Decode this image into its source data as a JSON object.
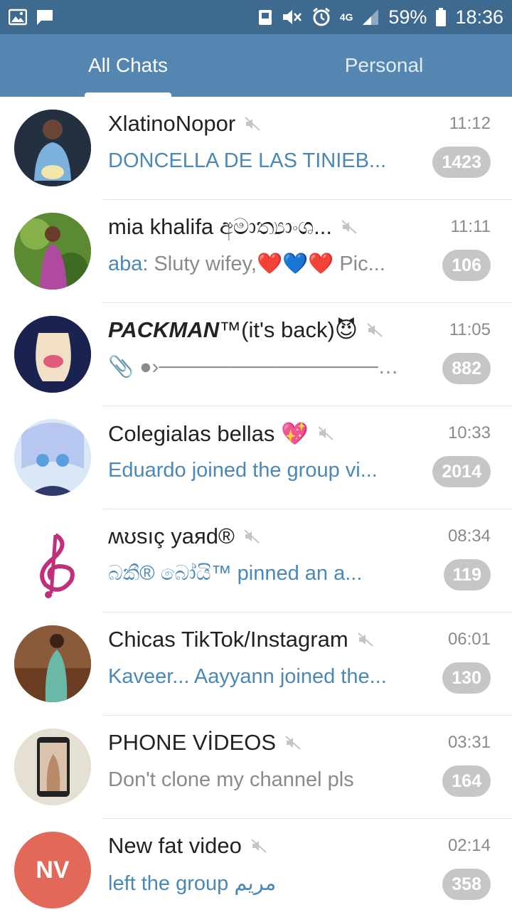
{
  "status_bar": {
    "battery": "59%",
    "time": "18:36",
    "network": "4G",
    "icons": [
      "image-icon",
      "message-icon",
      "save-icon",
      "mute-icon",
      "alarm-icon",
      "signal-icon",
      "battery-icon"
    ]
  },
  "tabs": [
    {
      "label": "All Chats",
      "active": true
    },
    {
      "label": "Personal",
      "active": false
    }
  ],
  "chats": [
    {
      "title": "XlatinoNopor",
      "time": "11:12",
      "preview": "DONCELLA DE LAS TINIEB...",
      "badge": "1423",
      "muted": true
    },
    {
      "title": "mia khalifa අමාත්‍යාංශ...",
      "time": "11:11",
      "preview_sender": "aba:",
      "preview": "Sluty wifey,❤️💙❤️ Pic...",
      "badge": "106",
      "muted": true
    },
    {
      "title_bold": "PACKMAN",
      "title_rest": "™(it's back)😈",
      "time": "11:05",
      "preview": "📎 ●›───────────────── 🔞...",
      "badge": "882",
      "muted": true
    },
    {
      "title": "Colegialas bellas 💖",
      "time": "10:33",
      "preview": "Eduardo joined the group vi...",
      "badge": "2014",
      "muted": true
    },
    {
      "title": "ʍʊsıç yaяd®",
      "time": "08:34",
      "preview": "බකී® බෝයි™ pinned an a...",
      "badge": "119",
      "muted": true
    },
    {
      "title": "Chicas TikTok/Instagram",
      "time": "06:01",
      "preview": "Kaveer... Aayyann joined the...",
      "badge": "130",
      "muted": true
    },
    {
      "title": "PHONE VİDEOS",
      "time": "03:31",
      "preview": "Don't clone my channel pls",
      "badge": "164",
      "muted": true
    },
    {
      "title": "New fat video",
      "time": "02:14",
      "preview": "left the group مريم",
      "badge": "358",
      "muted": true,
      "avatar_initials": "NV",
      "avatar_color": "#e2685a"
    }
  ]
}
